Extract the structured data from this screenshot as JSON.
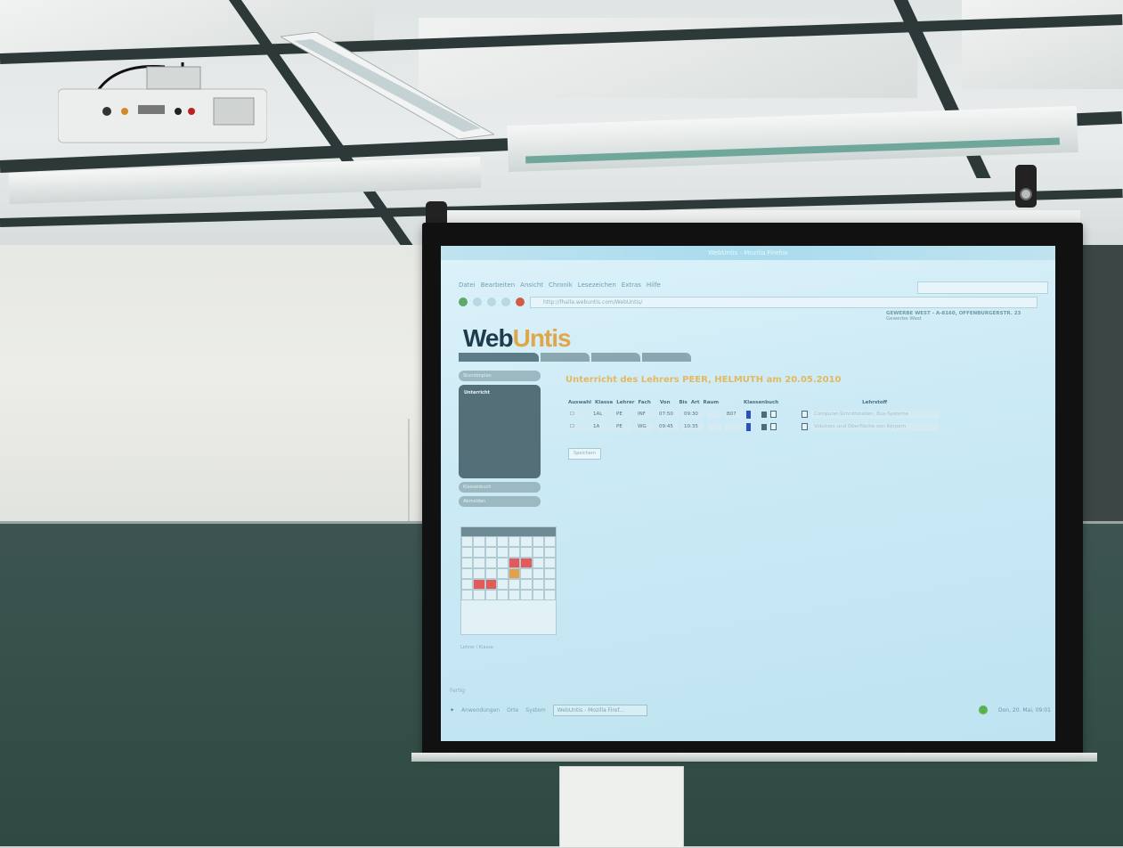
{
  "browser": {
    "window_title": "WebUntis - Mozilla Firefox",
    "menu": [
      "Datei",
      "Bearbeiten",
      "Ansicht",
      "Chronik",
      "Lesezeichen",
      "Extras",
      "Hilfe"
    ],
    "url": "http://fhalla.webuntis.com/WebUntis/",
    "status": "Fertig"
  },
  "webuntis": {
    "logo_web": "Web",
    "logo_untis": "Untis",
    "school": "GEWERBE WEST - A-8160, OFFENBURGERSTR. 23",
    "school_sub": "Gewerbe West",
    "sidebar_top": "Stundenplan",
    "panel_title": "Unterricht",
    "sidebar_buttons": [
      "Klassenbuch",
      "Abmelden"
    ],
    "heading": "Unterricht des Lehrers PEER, HELMUTH am 20.05.2010",
    "columns": [
      "Auswahl",
      "Klasse",
      "Lehrer",
      "Fach",
      "Von",
      "Bis",
      "Art",
      "Raum",
      "",
      "Klassenbuch",
      "",
      "Lehrstoff"
    ],
    "rows": [
      {
        "klasse": "1AL",
        "lehrer": "PE",
        "fach": "INF",
        "von": "07:50",
        "bis": "09:30",
        "raum": "B07",
        "lehrstoff": "Computer-Schnittstellen, Bus-Systeme"
      },
      {
        "klasse": "1A",
        "lehrer": "PE",
        "fach": "WG",
        "von": "09:45",
        "bis": "10:35",
        "raum": "",
        "lehrstoff": "Volumen und Oberfläche von Körpern"
      }
    ],
    "save": "Speichern",
    "footer_link": "Lehrer / Klasse"
  },
  "taskbar": {
    "items": [
      "Anwendungen",
      "Orte",
      "System"
    ],
    "window": "WebUntis - Mozilla Firef...",
    "clock": "Don, 20. Mai, 09:01"
  },
  "colors": {
    "accent": "#e0a64a",
    "screen": "#cbeaf5",
    "chalkboard": "#355049"
  }
}
